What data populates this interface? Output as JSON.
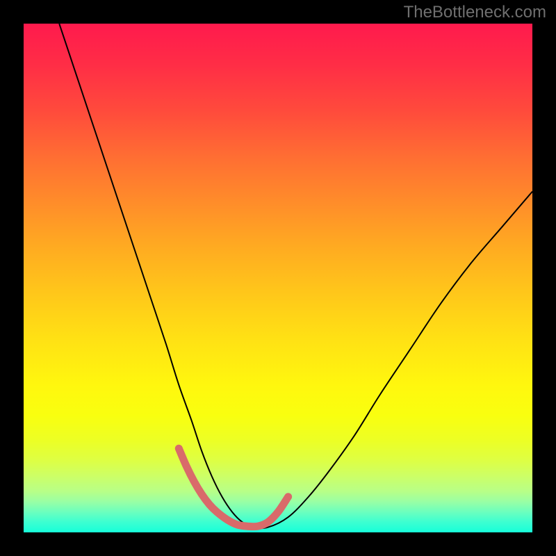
{
  "watermark": "TheBottleneck.com",
  "chart_data": {
    "type": "line",
    "title": "",
    "xlabel": "",
    "ylabel": "",
    "xlim": [
      0,
      100
    ],
    "ylim": [
      0,
      100
    ],
    "gradient_stops": [
      {
        "pos": 0,
        "color": "#ff1a4d"
      },
      {
        "pos": 8,
        "color": "#ff2d46"
      },
      {
        "pos": 17,
        "color": "#ff4a3c"
      },
      {
        "pos": 26,
        "color": "#ff6d33"
      },
      {
        "pos": 35,
        "color": "#ff8c2a"
      },
      {
        "pos": 44,
        "color": "#ffab21"
      },
      {
        "pos": 53,
        "color": "#ffc71a"
      },
      {
        "pos": 62,
        "color": "#ffe114"
      },
      {
        "pos": 71,
        "color": "#fff70e"
      },
      {
        "pos": 77,
        "color": "#f9ff0f"
      },
      {
        "pos": 82,
        "color": "#ecff25"
      },
      {
        "pos": 86,
        "color": "#ddff45"
      },
      {
        "pos": 89,
        "color": "#ccff67"
      },
      {
        "pos": 92,
        "color": "#b7ff88"
      },
      {
        "pos": 94,
        "color": "#98ffa5"
      },
      {
        "pos": 96,
        "color": "#6bffbe"
      },
      {
        "pos": 98,
        "color": "#3cffd1"
      },
      {
        "pos": 100,
        "color": "#17ffd9"
      }
    ],
    "series": [
      {
        "name": "bottleneck-curve",
        "stroke": "#000000",
        "stroke_width": 2,
        "x": [
          7,
          10,
          13,
          16,
          19,
          22,
          25,
          28,
          30.5,
          33,
          35,
          37,
          39,
          41,
          43,
          45,
          48,
          52,
          56,
          60,
          65,
          70,
          76,
          82,
          88,
          94,
          100
        ],
        "y": [
          100,
          91,
          82,
          73,
          64,
          55,
          46,
          37,
          29,
          22,
          16,
          11,
          7,
          4,
          2,
          1,
          1,
          3,
          7,
          12,
          19,
          27,
          36,
          45,
          53,
          60,
          67
        ]
      },
      {
        "name": "highlight-band",
        "stroke": "#d96a6a",
        "stroke_width": 11,
        "stroke_linecap": "round",
        "x": [
          30.5,
          32,
          33.5,
          35,
          36.5,
          38,
          40,
          42,
          44,
          46,
          48,
          50,
          52
        ],
        "y": [
          16.5,
          13,
          10,
          7.5,
          5.5,
          4,
          2.5,
          1.5,
          1.2,
          1.2,
          2,
          4,
          7
        ]
      }
    ]
  }
}
